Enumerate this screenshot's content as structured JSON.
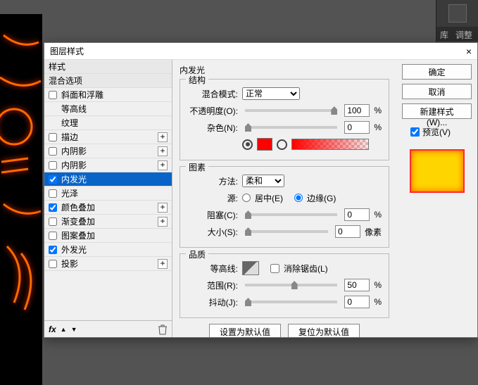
{
  "app_tabs": {
    "lib": "库",
    "adjust": "调整"
  },
  "dialog": {
    "title": "图层样式",
    "close": "×",
    "styles": {
      "header1": "样式",
      "header2": "混合选项",
      "items": [
        {
          "label": "斜面和浮雕",
          "checked": false,
          "plus": false
        },
        {
          "label": "等高线",
          "sub": true
        },
        {
          "label": "纹理",
          "sub": true
        },
        {
          "label": "描边",
          "checked": false,
          "plus": true
        },
        {
          "label": "内阴影",
          "checked": false,
          "plus": true
        },
        {
          "label": "内阴影",
          "checked": false,
          "plus": true
        },
        {
          "label": "内发光",
          "checked": true,
          "selected": true
        },
        {
          "label": "光泽",
          "checked": false
        },
        {
          "label": "颜色叠加",
          "checked": true,
          "plus": true
        },
        {
          "label": "渐变叠加",
          "checked": false,
          "plus": true
        },
        {
          "label": "图案叠加",
          "checked": false
        },
        {
          "label": "外发光",
          "checked": true
        },
        {
          "label": "投影",
          "checked": false,
          "plus": true
        }
      ],
      "fx": "fx"
    },
    "panel": {
      "title": "内发光",
      "group_structure": "结构",
      "blend_mode_label": "混合模式:",
      "blend_mode_value": "正常",
      "opacity_label": "不透明度(O):",
      "opacity_value": "100",
      "percent": "%",
      "noise_label": "杂色(N):",
      "noise_value": "0",
      "swatch_color": "#ff0000",
      "group_elements": "图素",
      "technique_label": "方法:",
      "technique_value": "柔和",
      "source_label": "源:",
      "source_center": "居中(E)",
      "source_edge": "边缘(G)",
      "choke_label": "阻塞(C):",
      "choke_value": "0",
      "size_label": "大小(S):",
      "size_value": "0",
      "px": "像素",
      "group_quality": "品质",
      "contour_label": "等高线:",
      "antialias": "消除锯齿(L)",
      "range_label": "范围(R):",
      "range_value": "50",
      "jitter_label": "抖动(J):",
      "jitter_value": "0",
      "btn_default": "设置为默认值",
      "btn_reset": "复位为默认值"
    },
    "right": {
      "ok": "确定",
      "cancel": "取消",
      "new_style": "新建样式(W)...",
      "preview": "预览(V)"
    }
  }
}
